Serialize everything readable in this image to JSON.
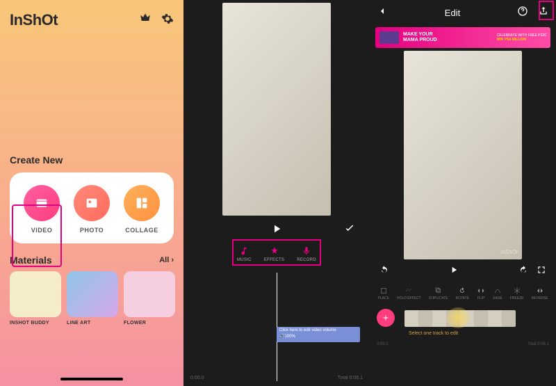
{
  "home": {
    "logo": "InShOt",
    "section_create": "Create New",
    "create": [
      {
        "label": "VIDEO"
      },
      {
        "label": "PHOTO"
      },
      {
        "label": "COLLAGE"
      }
    ],
    "section_materials": "Materials",
    "materials_all": "All ›",
    "materials": [
      {
        "label": "INSHOT BUDDY"
      },
      {
        "label": "LINE ART"
      },
      {
        "label": "FLOWER"
      }
    ]
  },
  "music_panel": {
    "tabs": [
      {
        "label": "MUSIC"
      },
      {
        "label": "EFFECTS"
      },
      {
        "label": "RECORD"
      }
    ],
    "volume_hint": "Click here to edit video volume",
    "volume_value": "🔊100%",
    "time_left": "0:00.0",
    "time_right": "Total 0:06.1"
  },
  "edit_panel": {
    "title": "Edit",
    "ad": {
      "line1": "MAKE YOUR",
      "line2": "MAMA PROUD",
      "cta1": "CELEBRATE WITH FREE P320",
      "cta2": "WIN PS4 MILLION"
    },
    "watermark": "InShOt",
    "tools": [
      {
        "label": "PLACE"
      },
      {
        "label": "HOLD EFFECT"
      },
      {
        "label": "DUPLICATE"
      },
      {
        "label": "ROTATE"
      },
      {
        "label": "FLIP"
      },
      {
        "label": "EASE"
      },
      {
        "label": "FREEZE"
      },
      {
        "label": "REVERSE"
      }
    ],
    "track_hint": "Select one track to edit",
    "time_left": "0:00.0",
    "time_right": "Total 0:06.1"
  }
}
